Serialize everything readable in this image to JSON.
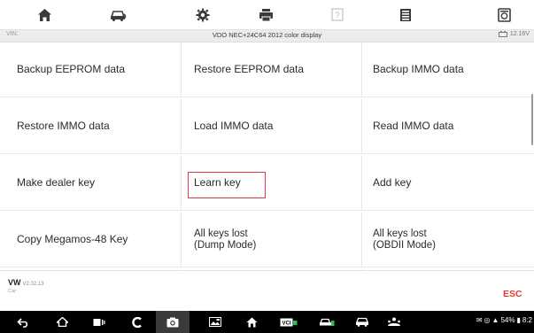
{
  "toolbar": {
    "icons": [
      "home-icon",
      "vehicle-icon",
      "settings-icon",
      "print-icon",
      "help-icon",
      "save-icon",
      "data-logging-icon"
    ]
  },
  "infobar": {
    "vin_label": "VIN:",
    "title": "VDO NEC+24C64 2012 color display",
    "voltage": "12.16V"
  },
  "functions": [
    {
      "label": "Backup EEPROM data"
    },
    {
      "label": "Restore EEPROM data"
    },
    {
      "label": "Backup IMMO data"
    },
    {
      "label": "Restore IMMO data"
    },
    {
      "label": "Load IMMO data"
    },
    {
      "label": "Read IMMO data"
    },
    {
      "label": "Make dealer key"
    },
    {
      "label": "Learn key"
    },
    {
      "label": "Add key"
    },
    {
      "label": "Copy Megamos-48 Key"
    },
    {
      "label": "All keys lost\n(Dump Mode)"
    },
    {
      "label": "All keys lost\n(OBDII Mode)"
    }
  ],
  "selected_function": "Learn key",
  "bottom": {
    "make": "VW",
    "version": "V2.02.13",
    "car_label": "Car:",
    "esc_label": "ESC"
  },
  "status_bar": {
    "battery": "54%",
    "time": "8:2"
  },
  "colors": {
    "accent": "#e23b2e",
    "highlight": "#e0373d",
    "navbar": "#000000"
  }
}
